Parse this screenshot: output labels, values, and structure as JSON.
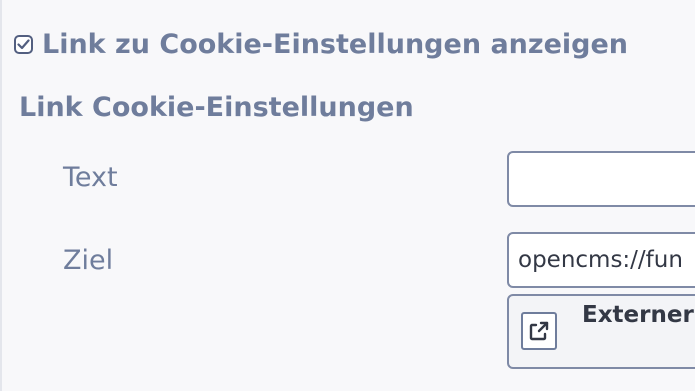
{
  "cookie_link_toggle": {
    "checked": true,
    "label": "Link zu Cookie-Einstellungen anzeigen"
  },
  "section": {
    "heading": "Link Cookie-Einstellungen"
  },
  "fields": {
    "text_label": "Text",
    "text_value": "",
    "ziel_label": "Ziel",
    "ziel_value": "opencms://fun",
    "external_button_label": "Externer"
  },
  "icons": {
    "checkbox": "checkmark-icon",
    "external": "external-link-icon"
  }
}
